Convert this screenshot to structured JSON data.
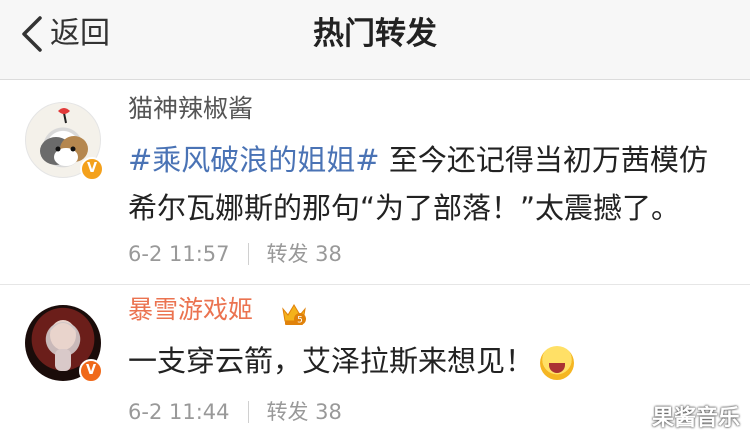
{
  "nav": {
    "back_label": "返回",
    "title": "热门转发"
  },
  "reposts": [
    {
      "username": "猫神辣椒酱",
      "hashtag": "#乘风破浪的姐姐#",
      "text_line1": " 至今还记得当初万茜模仿",
      "text_line2": "希尔瓦娜斯的那句“为了部落！”太震撼了。",
      "time": "6-2 11:57",
      "repost_label": "转发 38",
      "badge": "V",
      "avatar_icon": "cat-avatar-icon"
    },
    {
      "username": "暴雪游戏姬",
      "text": "一支穿云箭，艾泽拉斯来想见！",
      "time": "6-2 11:44",
      "repost_label": "转发 38",
      "badge": "V",
      "avatar_icon": "game-character-avatar-icon",
      "vip_icon": "vip-crown-icon",
      "emoji_icon": "laughing-emoji-icon"
    }
  ],
  "watermark": "果酱音乐",
  "colors": {
    "hashtag": "#4a73b5",
    "vip_name": "#eb7350",
    "badge": "#f4a11c",
    "meta": "#999999"
  }
}
